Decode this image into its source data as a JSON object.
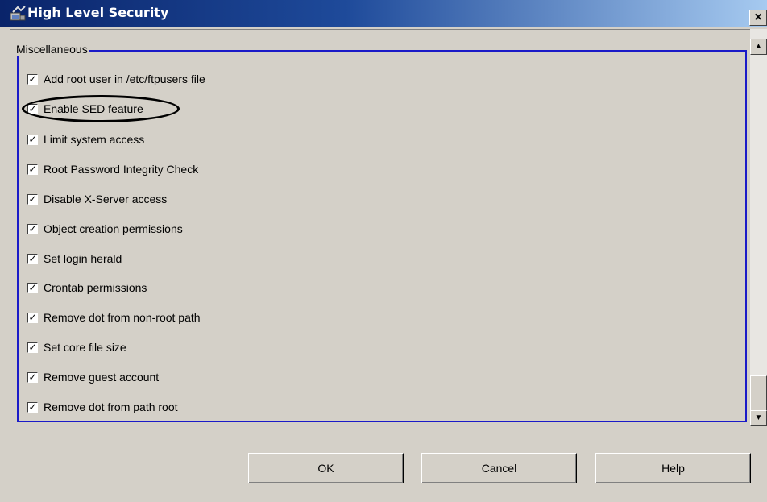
{
  "window": {
    "title": "High Level Security",
    "close_glyph": "×"
  },
  "group": {
    "legend": "Miscellaneous",
    "items": [
      {
        "label": "Add root user in /etc/ftpusers file",
        "checked": true
      },
      {
        "label": "Enable SED feature",
        "checked": true,
        "highlighted": true
      },
      {
        "label": "Limit system access",
        "checked": true
      },
      {
        "label": "Root Password Integrity Check",
        "checked": true
      },
      {
        "label": "Disable X-Server access",
        "checked": true
      },
      {
        "label": "Object creation permissions",
        "checked": true
      },
      {
        "label": "Set login herald",
        "checked": true
      },
      {
        "label": "Crontab permissions",
        "checked": true
      },
      {
        "label": "Remove dot from non-root path",
        "checked": true
      },
      {
        "label": "Set core file size",
        "checked": true
      },
      {
        "label": "Remove guest account",
        "checked": true
      },
      {
        "label": "Remove dot from path root",
        "checked": true
      }
    ]
  },
  "buttons": {
    "ok": "OK",
    "cancel": "Cancel",
    "help": "Help"
  },
  "icons": {
    "title": "security-app-icon",
    "scroll_up": "arrow-up-icon",
    "scroll_down": "arrow-down-icon"
  },
  "colors": {
    "titlebar": "#0a246a",
    "group_border": "#1a1ac8",
    "face": "#d4d0c8"
  },
  "check_glyph": "✓"
}
